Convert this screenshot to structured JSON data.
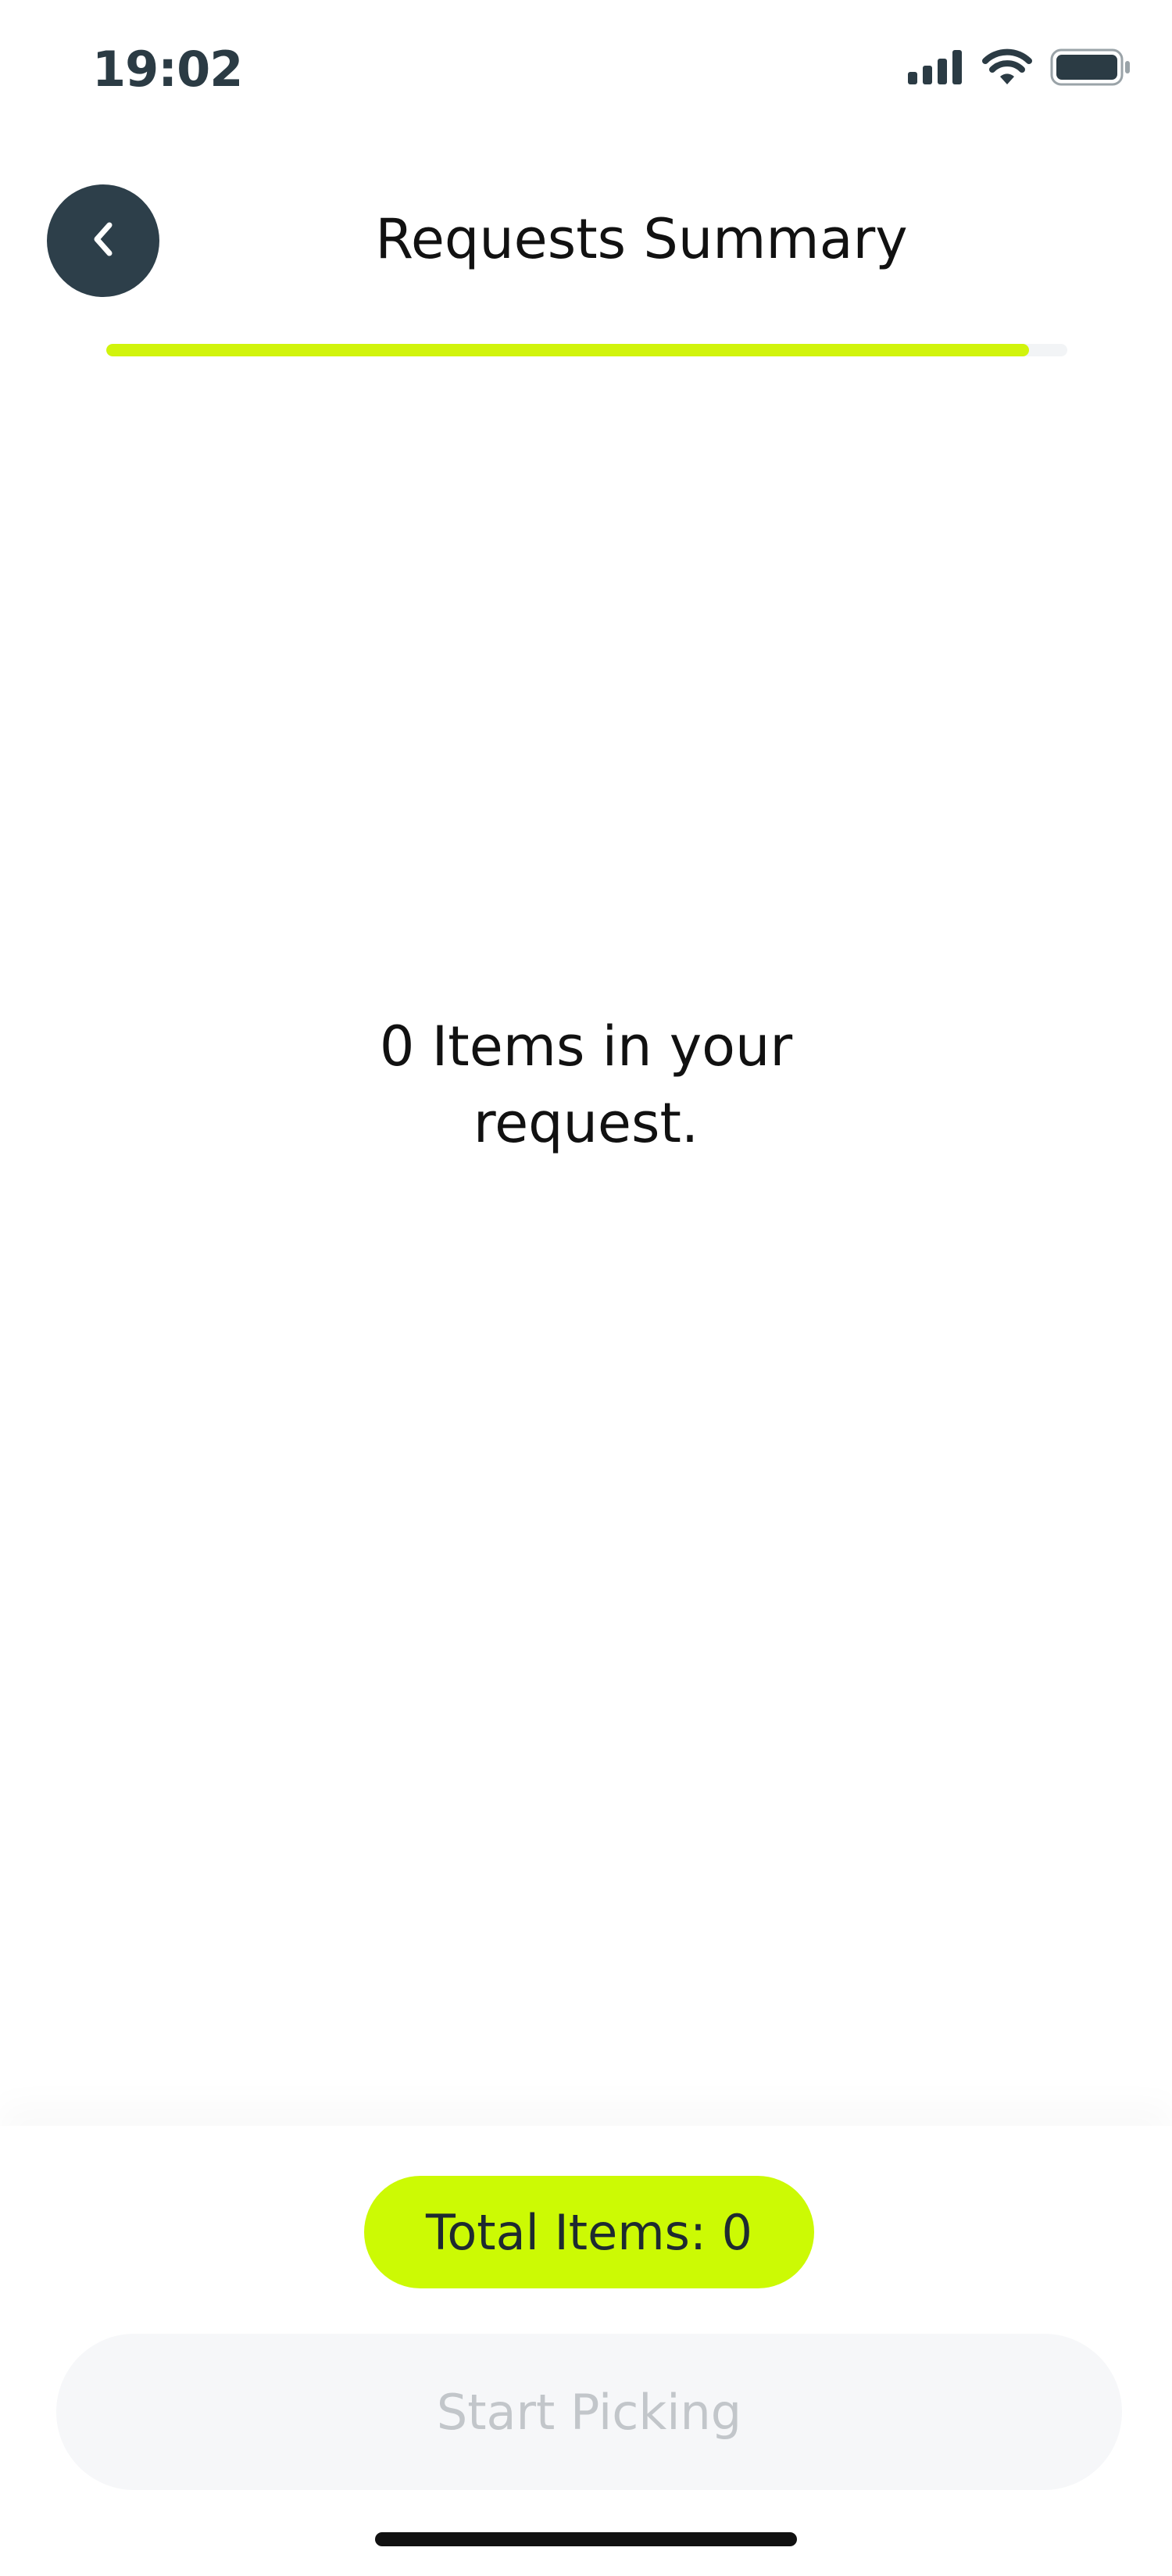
{
  "status_bar": {
    "time": "19:02",
    "icons": [
      "cellular-signal-icon",
      "wifi-icon",
      "battery-icon"
    ]
  },
  "header": {
    "title": "Requests Summary",
    "back_icon": "chevron-left-icon",
    "progress_fraction": 0.96
  },
  "main": {
    "empty_message": "0 Items in your request."
  },
  "footer": {
    "total_label": "Total Items: 0",
    "start_button_label": "Start Picking"
  },
  "colors": {
    "accent": "#ccfa04",
    "dark": "#2d3f4a",
    "disabled_text": "#c2c6ca",
    "disabled_bg": "#f6f7f9"
  }
}
